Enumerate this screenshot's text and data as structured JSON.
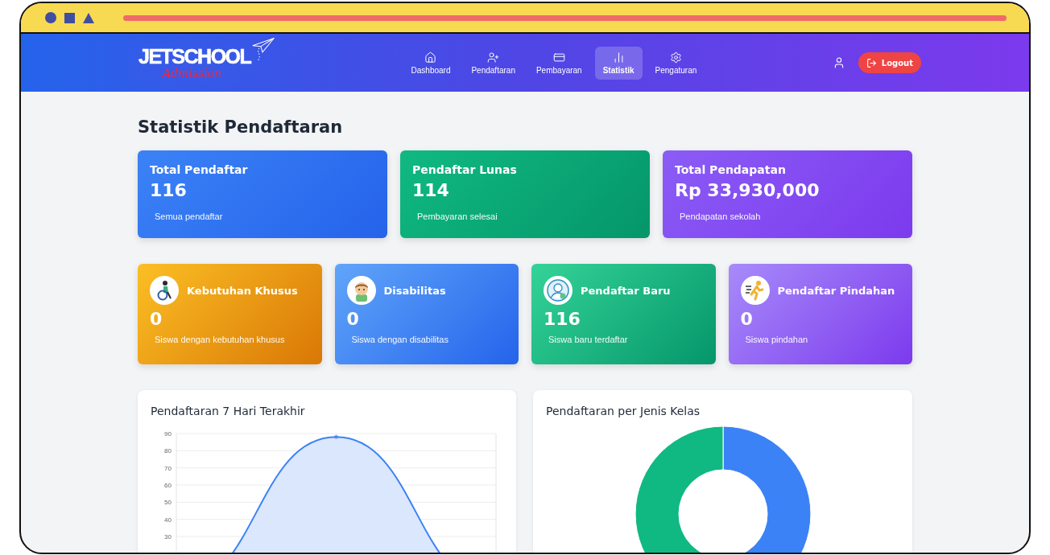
{
  "logo": {
    "name": "JETSCHOOL",
    "tagline": "Admission"
  },
  "nav": [
    {
      "label": "Dashboard",
      "kind": "home",
      "selected": false
    },
    {
      "label": "Pendaftaran",
      "kind": "user-plus",
      "selected": false
    },
    {
      "label": "Pembayaran",
      "kind": "card",
      "selected": false
    },
    {
      "label": "Statistik",
      "kind": "chart",
      "selected": true
    },
    {
      "label": "Pengaturan",
      "kind": "settings",
      "selected": false
    }
  ],
  "logout": "Logout",
  "page_title": "Statistik Pendaftaran",
  "summary_cards": [
    {
      "title": "Total Pendaftar",
      "value": "116",
      "note": "Semua pendaftar"
    },
    {
      "title": "Pendaftar Lunas",
      "value": "114",
      "note": "Pembayaran selesai"
    },
    {
      "title": "Total Pendapatan",
      "value": "Rp 33,930,000",
      "note": "Pendapatan sekolah"
    }
  ],
  "category_cards": [
    {
      "title": "Kebutuhan Khusus",
      "value": "0",
      "note": "Siswa dengan kebutuhan khusus",
      "kind": "wheelchair"
    },
    {
      "title": "Disabilitas",
      "value": "0",
      "note": "Siswa dengan disabilitas",
      "kind": "child"
    },
    {
      "title": "Pendaftar Baru",
      "value": "116",
      "note": "Siswa baru terdaftar",
      "kind": "avatar"
    },
    {
      "title": "Pendaftar Pindahan",
      "value": "0",
      "note": "Siswa pindahan",
      "kind": "runner"
    }
  ],
  "line_panel": {
    "title": "Pendaftaran 7 Hari Terakhir",
    "chart_data": {
      "type": "line",
      "grid": true,
      "series": [
        {
          "color": "#3b82f6",
          "values": [
            0,
            88,
            0
          ]
        }
      ],
      "ylim": [
        0,
        90
      ],
      "yticks": [
        30,
        40,
        50,
        60,
        70,
        80,
        90
      ]
    }
  },
  "donut_panel": {
    "title": "Pendaftaran per Jenis Kelas"
  }
}
